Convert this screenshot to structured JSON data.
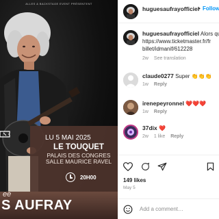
{
  "post_image": {
    "top_text": "ALLES & BACKSTAGE EVENT PRÉSENTENT",
    "date": "LU 5 MAI 2025",
    "city": "LE TOUQUET",
    "venue_line1": "PALAIS DES CONGRES",
    "venue_line2": "SALLE MAURICE RAVEL",
    "time": "20H00",
    "artist_prefix": "ee",
    "artist_name": "S AUFRAY",
    "icons": [
      "ticket-icon",
      "clock-icon"
    ],
    "colors": {
      "band": "#4e342c",
      "backdrop": "#0d0d0d"
    }
  },
  "header": {
    "username": "huguesaufrayofficiel",
    "separator": "•",
    "follow_label": "Follow"
  },
  "caption": {
    "username": "huguesaufrayofficiel",
    "text": "Alors qu",
    "link_line1": "https://www.ticketmaster.fr/fr",
    "link_line2": "billet/idmanif/612228",
    "time": "2w",
    "see_translation": "See translation"
  },
  "comments": [
    {
      "username": "claude0277",
      "text": "Super 👏👏👏",
      "time": "1w",
      "reply": "Reply",
      "likes": ""
    },
    {
      "username": "irenepeyronnel",
      "text": "❤️❤️❤️",
      "time": "1w",
      "reply": "Reply",
      "likes": ""
    },
    {
      "username": "37dix",
      "text": "❤️",
      "time": "2w",
      "reply": "Reply",
      "likes": "1 like"
    }
  ],
  "actions": {
    "icons": [
      "heart-icon",
      "comment-icon",
      "share-icon",
      "bookmark-icon"
    ]
  },
  "likes": "149 likes",
  "date": "May 5",
  "add_comment": {
    "placeholder": "Add a comment…",
    "icon": "emoji-icon"
  },
  "colors": {
    "accent": "#0095f6",
    "text": "#262626",
    "muted": "#8e8e8e",
    "divider": "#efefef"
  }
}
